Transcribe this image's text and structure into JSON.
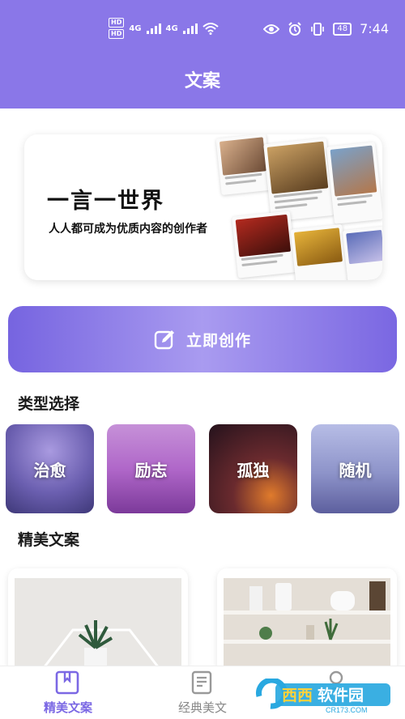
{
  "status_bar": {
    "time": "7:44",
    "battery": "48",
    "network": [
      "4G",
      "4G"
    ],
    "hd": [
      "HD",
      "HD"
    ]
  },
  "header": {
    "title": "文案"
  },
  "banner": {
    "headline": "一言一世界",
    "subline": "人人都可成为优质内容的创作者"
  },
  "cta": {
    "label": "立即创作",
    "icon": "edit-icon"
  },
  "categories": {
    "title": "类型选择",
    "items": [
      {
        "label": "治愈",
        "color": "#6b5fb0"
      },
      {
        "label": "励志",
        "color": "#b067c9"
      },
      {
        "label": "孤独",
        "color": "#3a1c2c"
      },
      {
        "label": "随机",
        "color": "#8d93c9"
      }
    ]
  },
  "featured": {
    "title": "精美文案"
  },
  "tabs": [
    {
      "label": "精美文案",
      "icon": "bookmark-book-icon",
      "active": true
    },
    {
      "label": "经典美文",
      "icon": "document-icon",
      "active": false
    },
    {
      "label": "",
      "icon": "user-icon",
      "active": false
    }
  ],
  "watermark": {
    "text": "西西软件园",
    "domain": "CR173.COM"
  },
  "colors": {
    "primary": "#8a77e8",
    "accent": "#7b68e4"
  }
}
